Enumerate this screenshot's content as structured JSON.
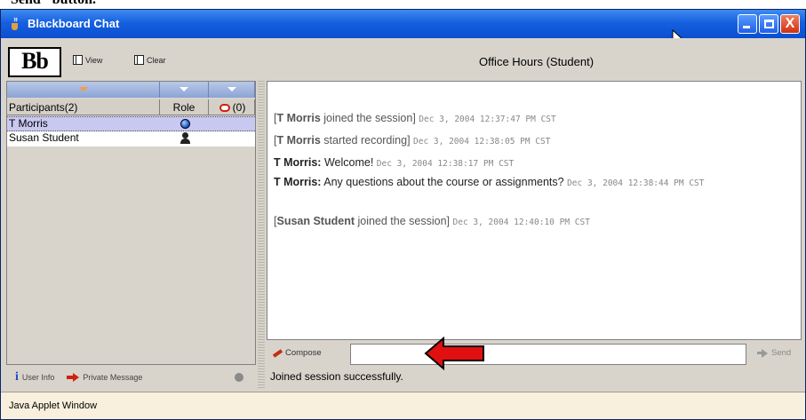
{
  "top_strip": {
    "cut_text_left": "Send\" button.",
    "cut_text_mid": ""
  },
  "window": {
    "title": "Blackboard Chat",
    "controls": {
      "minimize": "minimize",
      "maximize": "maximize",
      "close": "X"
    }
  },
  "toolbar": {
    "logo": "Bb",
    "view_label": "View",
    "clear_label": "Clear",
    "session_title": "Office Hours (Student)"
  },
  "participants": {
    "header": {
      "name": "Participants(2)",
      "role": "Role",
      "hand_count": "(0)"
    },
    "rows": [
      {
        "name": "T Morris",
        "role_icon": "globe-icon",
        "selected": true
      },
      {
        "name": "Susan Student",
        "role_icon": "person-icon",
        "selected": false
      }
    ],
    "footer": {
      "user_info": "User Info",
      "private_message": "Private Message"
    }
  },
  "chat": {
    "messages": [
      {
        "prefix": "[",
        "name": "T Morris",
        "text": " joined the session]",
        "ts": "Dec 3, 2004 12:37:47 PM CST",
        "type": "system"
      },
      {
        "prefix": "[",
        "name": "T Morris",
        "text": " started recording]",
        "ts": "Dec 3, 2004 12:38:05 PM CST",
        "type": "system"
      },
      {
        "prefix": "",
        "name": "T Morris:",
        "text": " Welcome!",
        "ts": "Dec 3, 2004 12:38:17 PM CST",
        "type": "user"
      },
      {
        "prefix": "",
        "name": "T Morris:",
        "text": " Any questions about the course or assignments?",
        "ts": "Dec 3, 2004 12:38:44 PM CST",
        "type": "user"
      },
      {
        "prefix": "[",
        "name": "Susan Student",
        "text": " joined the session]",
        "ts": "Dec 3, 2004 12:40:10 PM CST",
        "type": "system"
      }
    ]
  },
  "compose": {
    "compose_label": "Compose",
    "input_value": "",
    "send_label": "Send"
  },
  "status": "Joined session successfully.",
  "applet_label": "Java Applet Window",
  "colors": {
    "title_blue": "#0a4fd0",
    "highlight": "#c8c8f0",
    "arrow_red": "#e01010"
  }
}
